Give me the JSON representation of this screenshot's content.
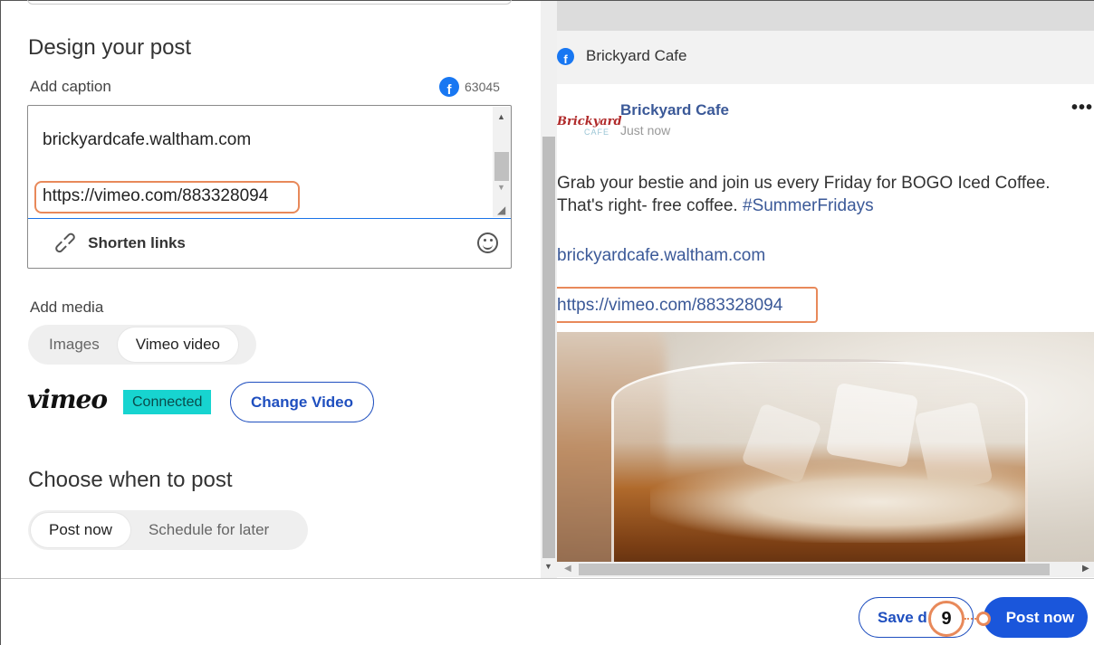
{
  "design": {
    "heading": "Design your post",
    "caption_label": "Add caption",
    "char_count": "63045",
    "caption_line_site": "brickyardcafe.waltham.com",
    "caption_line_link": "https://vimeo.com/883328094",
    "shorten_links": "Shorten links"
  },
  "media": {
    "label": "Add media",
    "tabs": [
      "Images",
      "Vimeo video"
    ],
    "vimeo_logo": "vimeo",
    "status_badge": "Connected",
    "change_video": "Change Video"
  },
  "schedule": {
    "heading": "Choose when to post",
    "options": [
      "Post now",
      "Schedule for later"
    ]
  },
  "preview": {
    "page_name": "Brickyard Cafe",
    "logo_text_main": "Brickyard",
    "logo_text_sub": "CAFE",
    "author": "Brickyard Cafe",
    "time": "Just now",
    "more": "•••",
    "body_line1": "Grab your bestie and join us every Friday for BOGO Iced Coffee.",
    "body_line2_prefix": "That's right- free coffee.",
    "hashtag": "#SummerFridays",
    "site": "brickyardcafe.waltham.com",
    "link": "https://vimeo.com/883328094"
  },
  "footer": {
    "save_label": "Save d",
    "post_now_label": "Post now",
    "step_number": "9"
  },
  "colors": {
    "accent_blue": "#1a56db",
    "highlight_orange": "#e8895a",
    "connected_teal": "#17d4d0",
    "facebook_blue": "#1877f2"
  },
  "icons": {
    "facebook": "facebook-icon",
    "link": "link-icon",
    "emoji": "smiley-icon",
    "more": "more-horizontal-icon"
  }
}
